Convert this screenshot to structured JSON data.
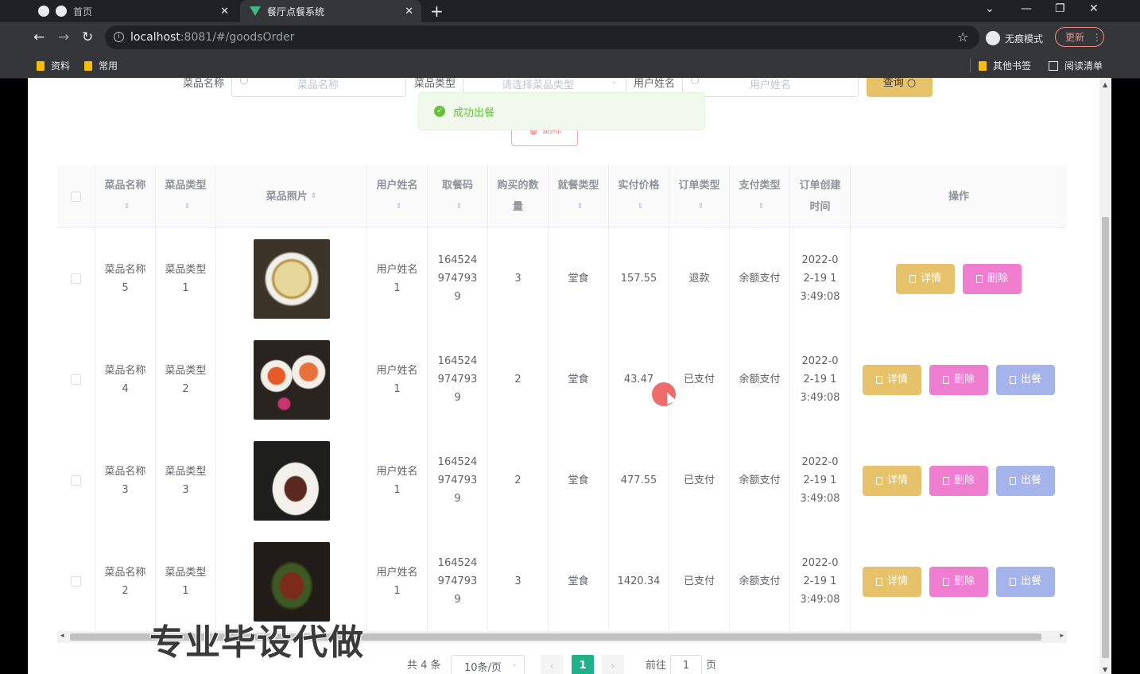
{
  "browser": {
    "tabs": [
      {
        "title": "首页",
        "active": false
      },
      {
        "title": "餐厅点餐系统",
        "active": true
      }
    ],
    "url_host": "localhost",
    "url_port_path": ":8081/#/goodsOrder",
    "incognito_label": "无痕模式",
    "update_label": "更新",
    "bookmarks": [
      "资料",
      "常用"
    ],
    "other_bookmarks": "其他书签",
    "reading_list": "阅读清单"
  },
  "search": {
    "dish_name_label": "菜品名称",
    "dish_name_placeholder": "菜品名称",
    "dish_type_label": "菜品类型",
    "dish_type_placeholder": "请选择菜品类型",
    "user_name_label": "用户姓名",
    "user_name_placeholder": "用户姓名",
    "query_label": "查询",
    "delete_label": "删除"
  },
  "toast": {
    "message": "成功出餐",
    "color": "#67c23a"
  },
  "table": {
    "headers": {
      "dish_name": "菜品名称",
      "dish_type": "菜品类型",
      "dish_photo": "菜品照片",
      "user_name": "用户姓名",
      "pickup_code": "取餐码",
      "quantity": "购买的数量",
      "dining_type": "就餐类型",
      "paid_price": "实付价格",
      "order_type": "订单类型",
      "payment_type": "支付类型",
      "created_time": "订单创建时间",
      "actions": "操作"
    },
    "actions": {
      "detail": "详情",
      "delete": "删除",
      "serve": "出餐"
    },
    "rows": [
      {
        "dish_name": "菜品名称5",
        "dish_type": "菜品类型1",
        "photo": "soup-dish",
        "user_name": "用户姓名1",
        "pickup_code": "1645249747939",
        "quantity": "3",
        "dining_type": "堂食",
        "paid_price": "157.55",
        "order_type": "退款",
        "payment_type": "余额支付",
        "created_time": "2022-02-19 13:49:08",
        "has_serve": false
      },
      {
        "dish_name": "菜品名称4",
        "dish_type": "菜品类型2",
        "photo": "dessert-cups",
        "user_name": "用户姓名1",
        "pickup_code": "1645249747939",
        "quantity": "2",
        "dining_type": "堂食",
        "paid_price": "43.47",
        "order_type": "已支付",
        "payment_type": "余额支付",
        "created_time": "2022-02-19 13:49:08",
        "has_serve": true
      },
      {
        "dish_name": "菜品名称3",
        "dish_type": "菜品类型3",
        "photo": "plated-meat",
        "user_name": "用户姓名1",
        "pickup_code": "1645249747939",
        "quantity": "2",
        "dining_type": "堂食",
        "paid_price": "477.55",
        "order_type": "已支付",
        "payment_type": "余额支付",
        "created_time": "2022-02-19 13:49:08",
        "has_serve": true
      },
      {
        "dish_name": "菜品名称2",
        "dish_type": "菜品类型1",
        "photo": "stir-fry",
        "user_name": "用户姓名1",
        "pickup_code": "1645249747939",
        "quantity": "3",
        "dining_type": "堂食",
        "paid_price": "1420.34",
        "order_type": "已支付",
        "payment_type": "余额支付",
        "created_time": "2022-02-19 13:49:08",
        "has_serve": true
      }
    ]
  },
  "pagination": {
    "total": "共 4 条",
    "page_size": "10条/页",
    "current_page": "1",
    "goto_label": "前往",
    "goto_value": "1",
    "page_suffix": "页"
  },
  "watermark": "专业毕设代做",
  "colors": {
    "accent": "#1fb28a",
    "detail": "#e6c26b",
    "delete": "#ef7ed1",
    "serve": "#a4b4ea"
  }
}
